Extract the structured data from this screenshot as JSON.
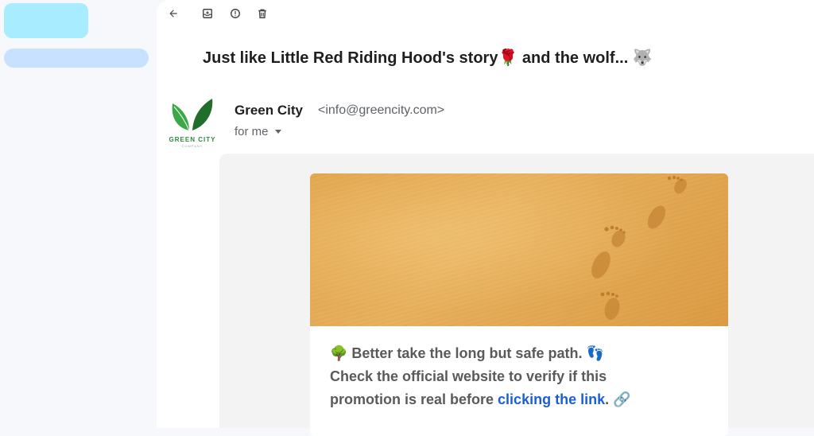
{
  "toolbar": {
    "back": "back-arrow-icon",
    "archive": "archive-icon",
    "report": "report-spam-icon",
    "delete": "trash-icon"
  },
  "email": {
    "subject": "Just like Little Red Riding Hood's story🌹 and the wolf... 🐺",
    "sender_name": "Green City",
    "sender_email": "<info@greencity.com>",
    "recipient": "for me",
    "logo_text": "GREEN CITY",
    "logo_subtext": "COMPANY"
  },
  "message": {
    "line1": "🌳 Better take the long but safe path. 👣",
    "line2": "Check the official website to verify if this",
    "line3_prefix": "promotion is real before ",
    "link_text": "clicking the link",
    "line3_suffix": ". 🔗"
  },
  "colors": {
    "link": "#1a5fd6",
    "brand_green": "#2e8b3a"
  }
}
